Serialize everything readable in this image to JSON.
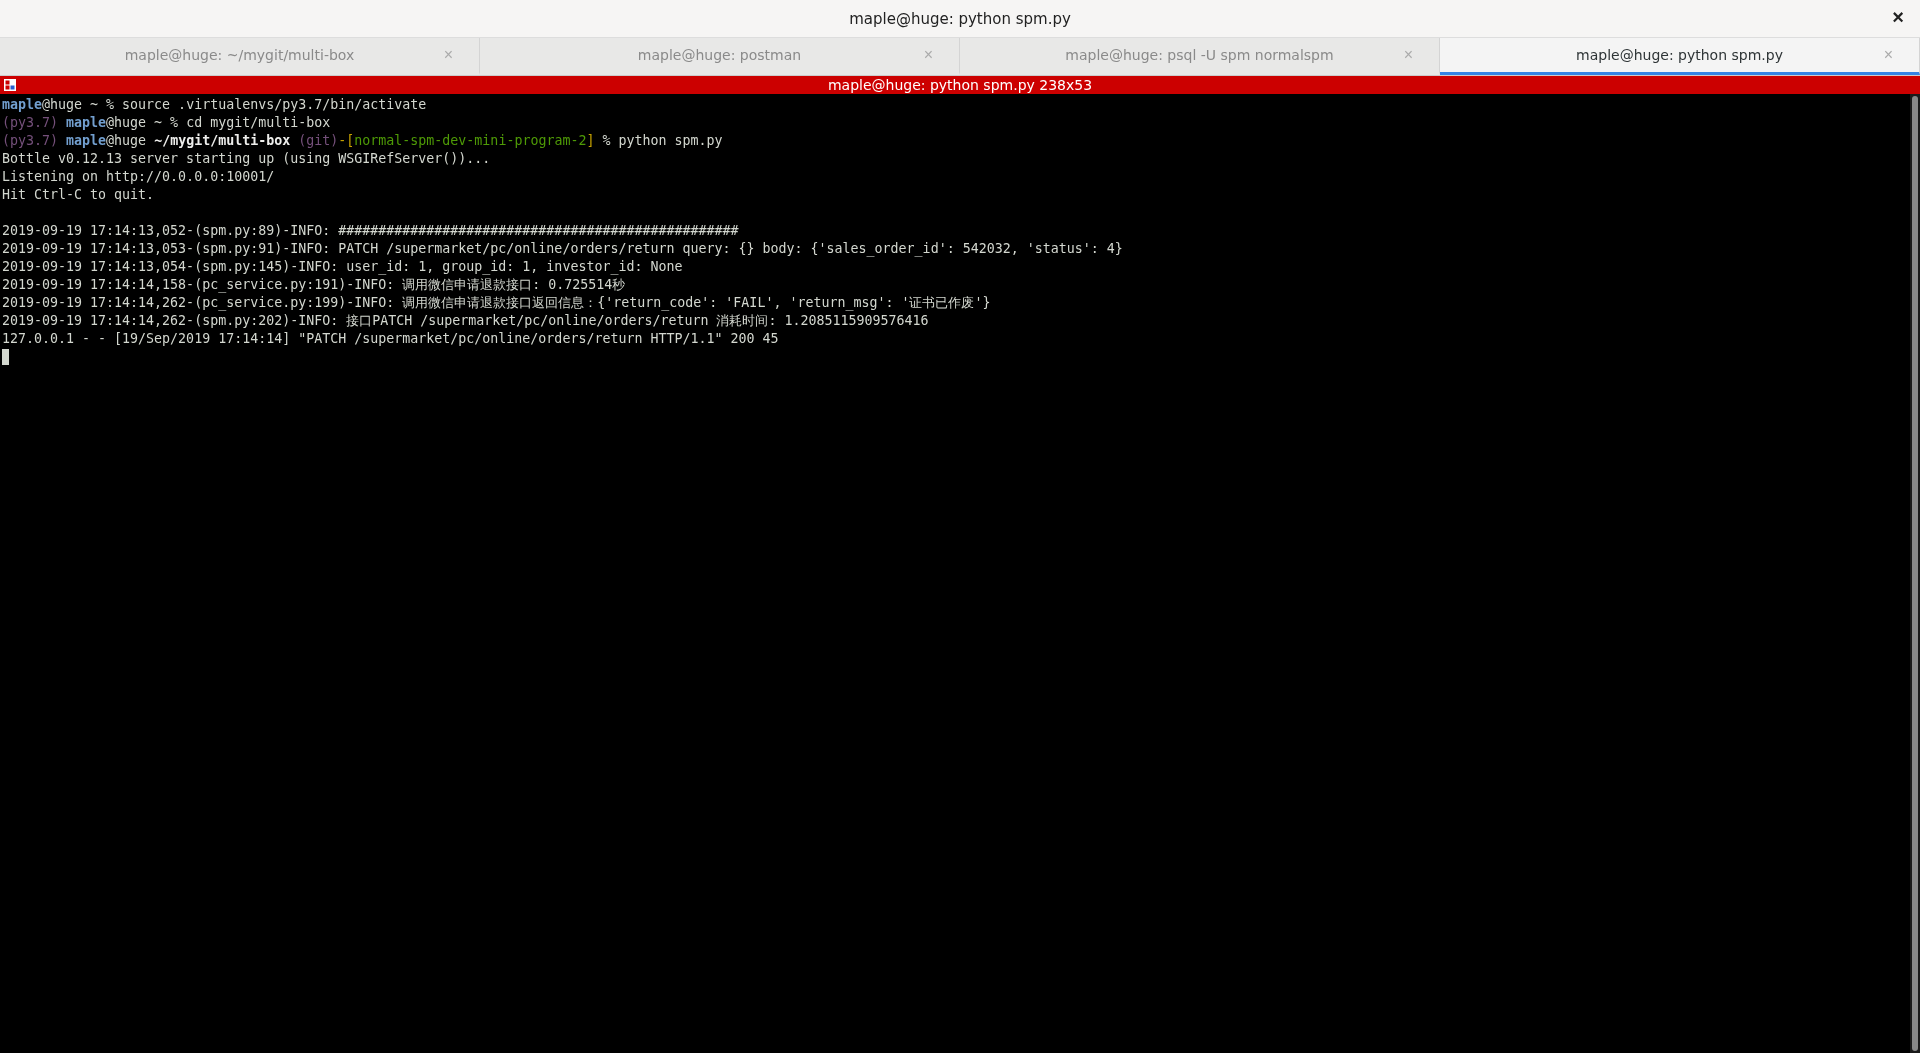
{
  "window": {
    "title": "maple@huge: python spm.py",
    "close": "×"
  },
  "tabs": [
    {
      "label": "maple@huge: ~/mygit/multi-box",
      "close": "×",
      "selected": false
    },
    {
      "label": "maple@huge: postman",
      "close": "×",
      "selected": false
    },
    {
      "label": "maple@huge: psql -U spm normalspm",
      "close": "×",
      "selected": false
    },
    {
      "label": "maple@huge: python spm.py",
      "close": "×",
      "selected": true
    }
  ],
  "pane_title": "maple@huge: python spm.py 238x53",
  "terminal": {
    "lines": [
      {
        "kind": "text",
        "segments": [
          {
            "kind": "user",
            "text": "maple"
          },
          {
            "kind": "plain",
            "text": "@huge ~ % source .virtualenvs/py3.7/bin/activate"
          }
        ]
      },
      {
        "kind": "text",
        "segments": [
          {
            "kind": "venv",
            "text": "(py3.7) "
          },
          {
            "kind": "user",
            "text": "maple"
          },
          {
            "kind": "plain",
            "text": "@huge ~ % cd mygit/multi-box"
          }
        ]
      },
      {
        "kind": "text",
        "segments": [
          {
            "kind": "venv",
            "text": "(py3.7) "
          },
          {
            "kind": "user",
            "text": "maple"
          },
          {
            "kind": "plain",
            "text": "@huge "
          },
          {
            "kind": "path",
            "text": "~/mygit/multi-box"
          },
          {
            "kind": "venv",
            "text": " (git)"
          },
          {
            "kind": "git",
            "text": "-["
          },
          {
            "kind": "branch",
            "text": "normal-spm-dev-mini-program-2"
          },
          {
            "kind": "git",
            "text": "]"
          },
          {
            "kind": "plain",
            "text": " % python spm.py"
          }
        ]
      },
      {
        "kind": "text",
        "segments": [
          {
            "kind": "plain",
            "text": "Bottle v0.12.13 server starting up (using WSGIRefServer())..."
          }
        ]
      },
      {
        "kind": "text",
        "segments": [
          {
            "kind": "plain",
            "text": "Listening on http://0.0.0.0:10001/"
          }
        ]
      },
      {
        "kind": "text",
        "segments": [
          {
            "kind": "plain",
            "text": "Hit Ctrl-C to quit."
          }
        ]
      },
      {
        "kind": "blank"
      },
      {
        "kind": "text",
        "segments": [
          {
            "kind": "plain",
            "text": "2019-09-19 17:14:13,052-(spm.py:89)-INFO: ##################################################"
          }
        ]
      },
      {
        "kind": "text",
        "segments": [
          {
            "kind": "plain",
            "text": "2019-09-19 17:14:13,053-(spm.py:91)-INFO: PATCH /supermarket/pc/online/orders/return query: {} body: {'sales_order_id': 542032, 'status': 4}"
          }
        ]
      },
      {
        "kind": "text",
        "segments": [
          {
            "kind": "plain",
            "text": "2019-09-19 17:14:13,054-(spm.py:145)-INFO: user_id: 1, group_id: 1, investor_id: None"
          }
        ]
      },
      {
        "kind": "text",
        "segments": [
          {
            "kind": "plain",
            "text": "2019-09-19 17:14:14,158-(pc_service.py:191)-INFO: 调用微信申请退款接口: 0.725514秒"
          }
        ]
      },
      {
        "kind": "text",
        "segments": [
          {
            "kind": "plain",
            "text": "2019-09-19 17:14:14,262-(pc_service.py:199)-INFO: 调用微信申请退款接口返回信息：{'return_code': 'FAIL', 'return_msg': '证书已作废'}"
          }
        ]
      },
      {
        "kind": "text",
        "segments": [
          {
            "kind": "plain",
            "text": "2019-09-19 17:14:14,262-(spm.py:202)-INFO: 接口PATCH /supermarket/pc/online/orders/return 消耗时间: 1.2085115909576416"
          }
        ]
      },
      {
        "kind": "text",
        "segments": [
          {
            "kind": "plain",
            "text": "127.0.0.1 - - [19/Sep/2019 17:14:14] \"PATCH /supermarket/pc/online/orders/return HTTP/1.1\" 200 45"
          }
        ]
      }
    ]
  }
}
